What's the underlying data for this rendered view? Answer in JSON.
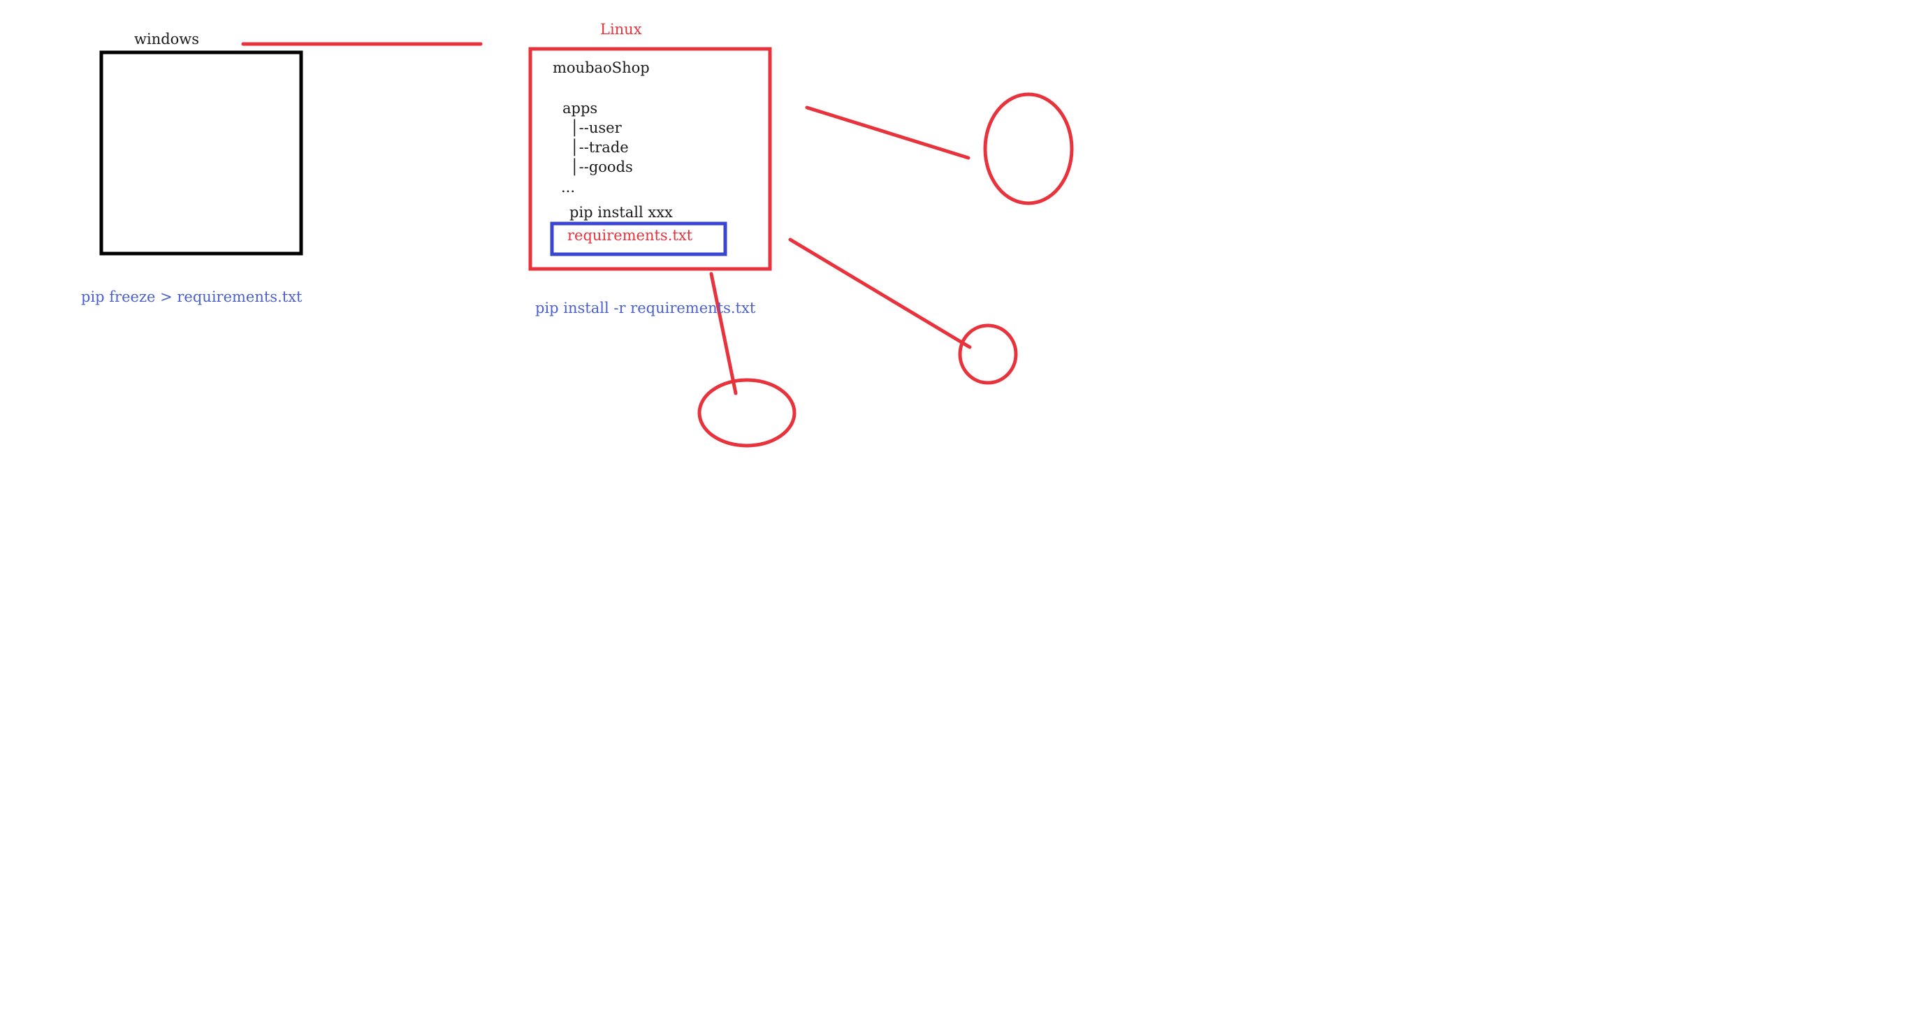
{
  "windows": {
    "label": "windows",
    "command": "pip freeze > requirements.txt"
  },
  "linux": {
    "label": "Linux",
    "project_name": "moubaoShop",
    "tree": {
      "folder": "apps",
      "children": [
        "│--user",
        "│--trade",
        "│--goods"
      ],
      "ellipsis": "..."
    },
    "pip_install": "pip install xxx",
    "requirements_file": "requirements.txt",
    "command": "pip install -r requirements.txt"
  },
  "colors": {
    "red": "#e8323c",
    "blue_box": "#3a46d0",
    "blue_text": "#4a5fd0",
    "black": "#000000"
  }
}
